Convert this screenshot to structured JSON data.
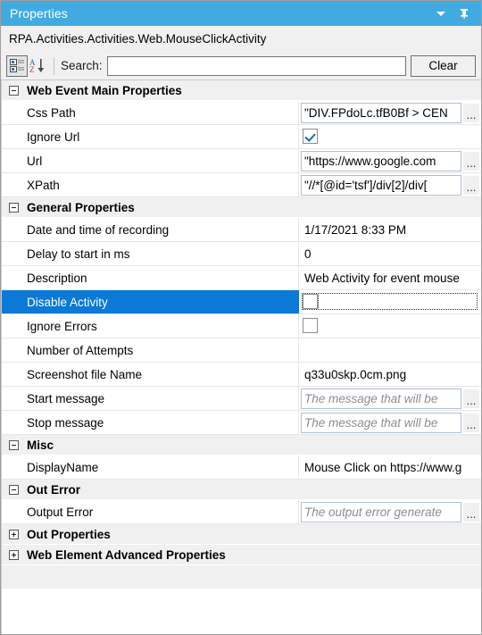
{
  "window": {
    "title": "Properties",
    "collapse_icon": "chevron-down-icon",
    "pin_icon": "pin-icon"
  },
  "type_line": "RPA.Activities.Activities.Web.MouseClickActivity",
  "toolbar": {
    "categorized_icon": "categorized-view-icon",
    "alphabetical_icon": "alphabetical-sort-icon",
    "search_label": "Search:",
    "search_value": "",
    "search_placeholder": "",
    "clear_label": "Clear"
  },
  "colors": {
    "titlebar": "#41abe1",
    "selection": "#0a7ad6",
    "category_bg": "#f0f0f0",
    "checkmark": "#1170ae"
  },
  "ellipsis_label": "...",
  "categories": [
    {
      "name": "Web Event Main Properties",
      "expanded": true,
      "rows": [
        {
          "name": "Css Path",
          "value": "\"DIV.FPdoLc.tfB0Bf > CEN",
          "kind": "textbox",
          "ellipsis": true
        },
        {
          "name": "Ignore Url",
          "value": "",
          "kind": "checkbox-checked",
          "ellipsis": false
        },
        {
          "name": "Url",
          "value": "\"https://www.google.com",
          "kind": "textbox",
          "ellipsis": true
        },
        {
          "name": "XPath",
          "value": "\"//*[@id='tsf']/div[2]/div[",
          "kind": "textbox",
          "ellipsis": true
        }
      ]
    },
    {
      "name": "General Properties",
      "expanded": true,
      "rows": [
        {
          "name": "Date and time of recording",
          "value": "1/17/2021 8:33 PM",
          "kind": "plain",
          "ellipsis": false
        },
        {
          "name": "Delay to start in ms",
          "value": "0",
          "kind": "plain",
          "ellipsis": false
        },
        {
          "name": "Description",
          "value": "Web Activity for event mouse",
          "kind": "plain",
          "ellipsis": false
        },
        {
          "name": "Disable Activity",
          "value": "",
          "kind": "checkbox-focused",
          "ellipsis": false,
          "selected": true
        },
        {
          "name": "Ignore Errors",
          "value": "",
          "kind": "checkbox-empty",
          "ellipsis": false
        },
        {
          "name": "Number of Attempts",
          "value": "",
          "kind": "plain",
          "ellipsis": false
        },
        {
          "name": "Screenshot file Name",
          "value": "q33u0skp.0cm.png",
          "kind": "plain",
          "ellipsis": false
        },
        {
          "name": "Start message",
          "value": "The message that will be",
          "kind": "placeholder",
          "ellipsis": true
        },
        {
          "name": "Stop message",
          "value": "The message that will be",
          "kind": "placeholder",
          "ellipsis": true
        }
      ]
    },
    {
      "name": "Misc",
      "expanded": true,
      "rows": [
        {
          "name": "DisplayName",
          "value": "Mouse Click on https://www.g",
          "kind": "plain",
          "ellipsis": false
        }
      ]
    },
    {
      "name": "Out Error",
      "expanded": true,
      "rows": [
        {
          "name": "Output Error",
          "value": "The output error generate",
          "kind": "placeholder",
          "ellipsis": true
        }
      ]
    },
    {
      "name": "Out Properties",
      "expanded": false,
      "rows": []
    },
    {
      "name": "Web Element Advanced Properties",
      "expanded": false,
      "rows": []
    }
  ]
}
